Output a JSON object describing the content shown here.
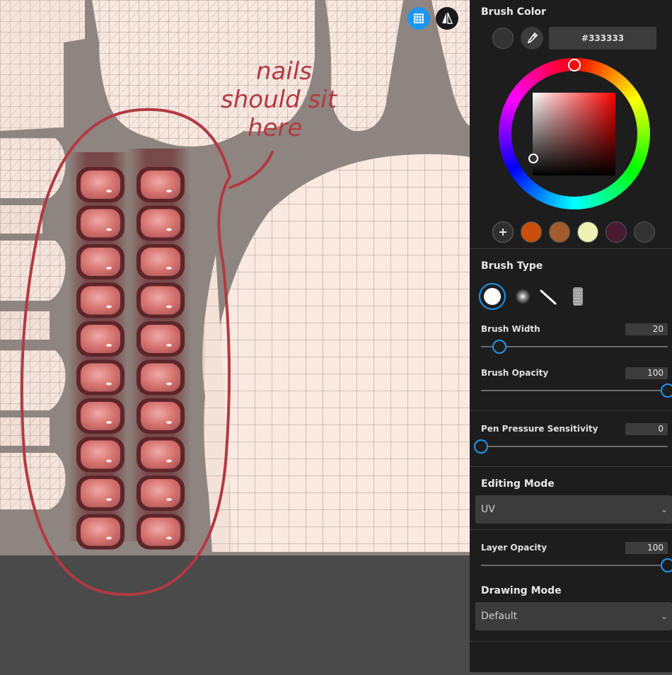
{
  "canvas": {
    "annotation": "nails\nshould sit\nhere"
  },
  "toolbar": {
    "grid_toggle_icon": "grid-icon",
    "symmetry_toggle_icon": "mirror-icon"
  },
  "brush_color": {
    "title": "Brush Color",
    "current_color": "#333333",
    "hex_value": "#333333",
    "swatches": [
      "#c94f0a",
      "#a15b2e",
      "#ebf2b4",
      "#4a1a33",
      "#333333"
    ],
    "add_swatch_icon": "plus-icon",
    "eyedropper_icon": "eyedropper-icon"
  },
  "brush_type": {
    "title": "Brush Type",
    "types": [
      "hard-round-brush",
      "soft-round-brush",
      "line-brush",
      "texture-brush"
    ],
    "selected": "hard-round-brush"
  },
  "brush_width": {
    "label": "Brush Width",
    "value": "20",
    "fraction": 0.1
  },
  "brush_opacity": {
    "label": "Brush Opacity",
    "value": "100",
    "fraction": 1.0
  },
  "pen_pressure": {
    "label": "Pen Pressure Sensitivity",
    "value": "0",
    "fraction": 0.0
  },
  "editing_mode": {
    "title": "Editing Mode",
    "selected": "UV"
  },
  "layer_opacity": {
    "label": "Layer Opacity",
    "value": "100",
    "fraction": 1.0
  },
  "drawing_mode": {
    "title": "Drawing Mode",
    "selected": "Default"
  },
  "colors": {
    "accent": "#1e96f0",
    "panel_bg": "#1d1d1d",
    "annotation": "#b13a42"
  }
}
